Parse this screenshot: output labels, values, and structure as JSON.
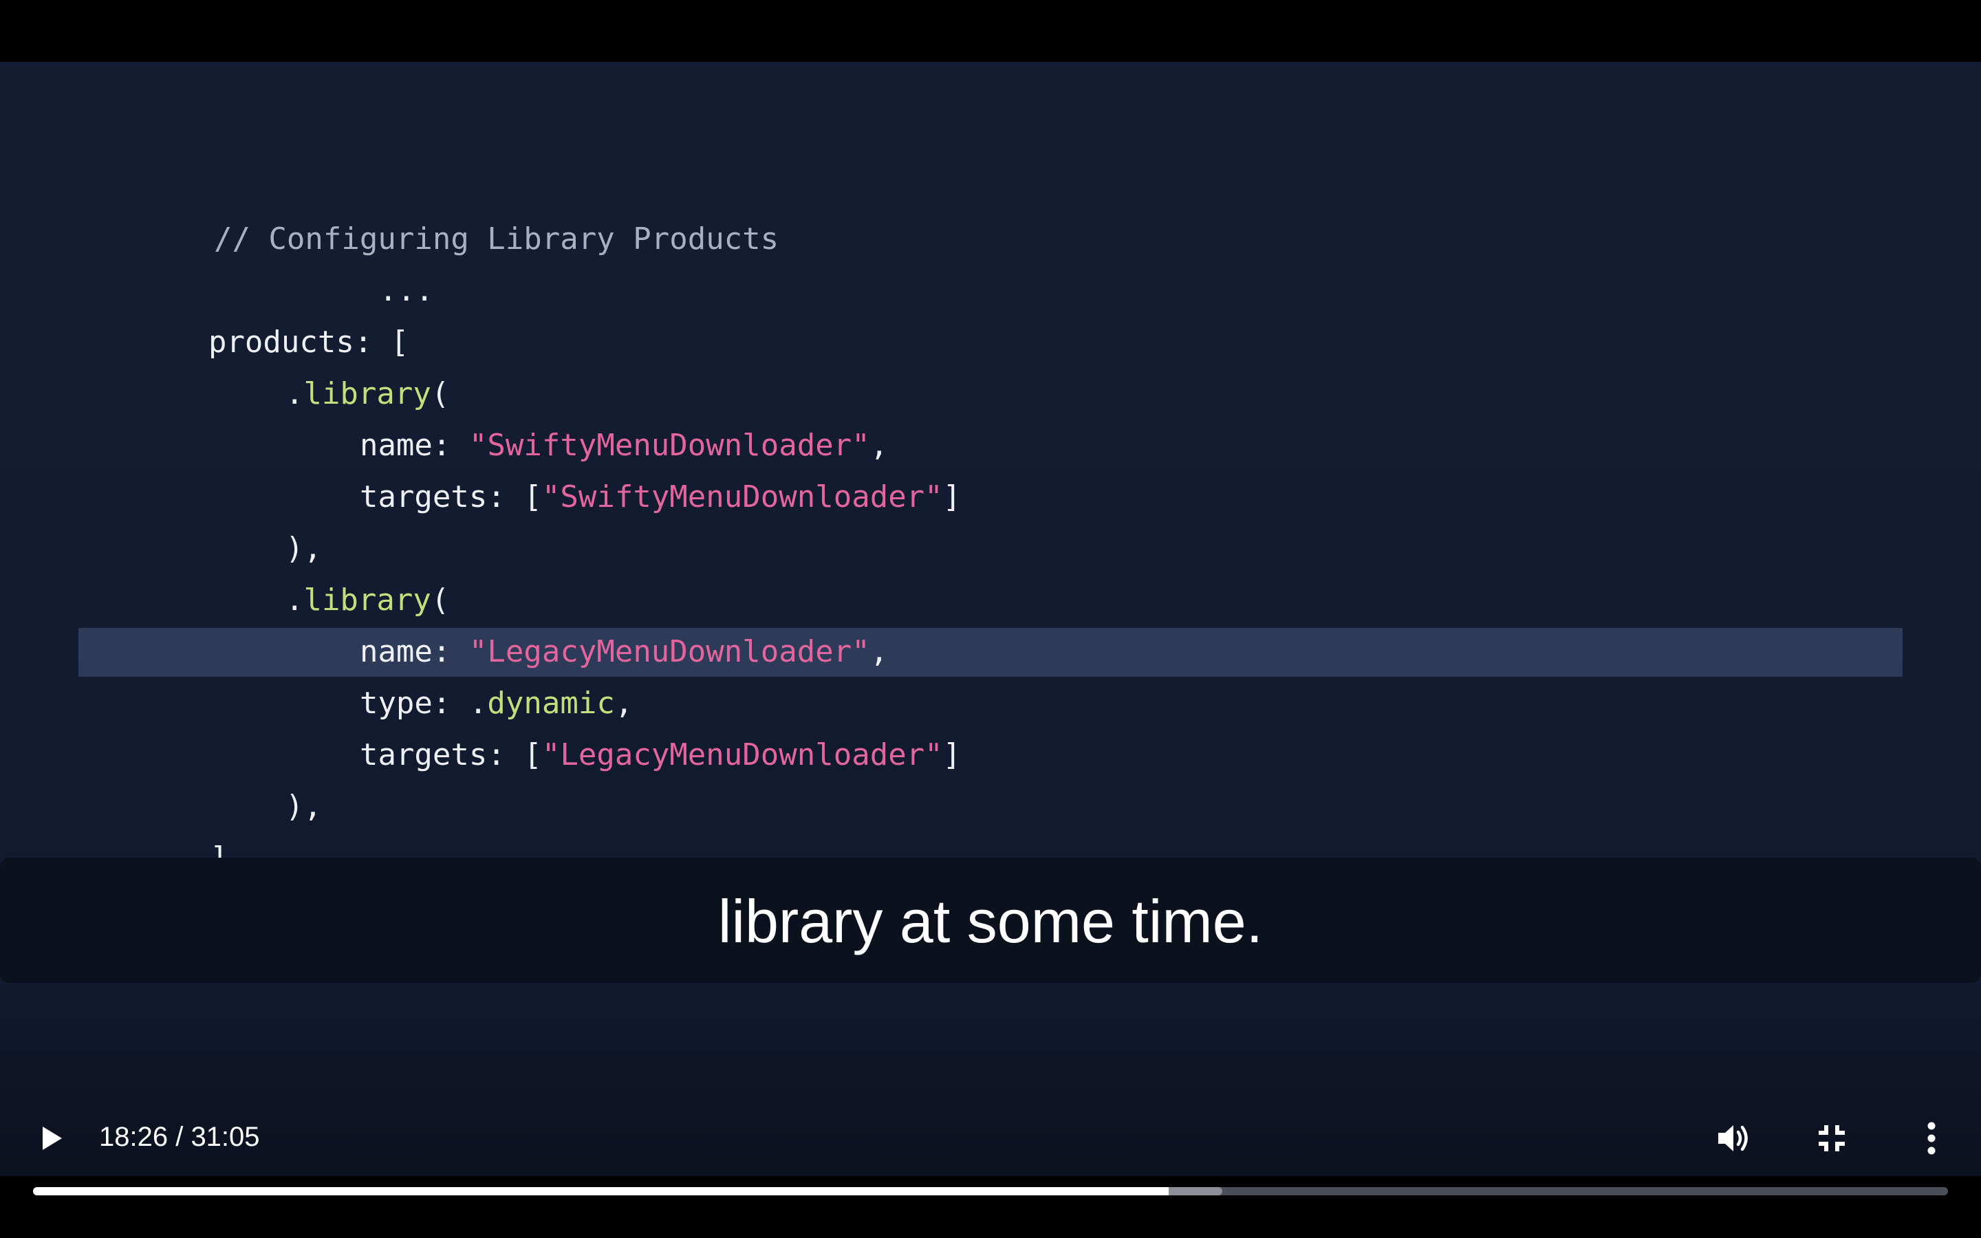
{
  "code": {
    "comment": "// Configuring Library Products",
    "ellipsis": "...",
    "products_key": "products:",
    "open_bracket": "[",
    "library_dot": ".",
    "library_func": "library",
    "open_paren": "(",
    "name_key": "name:",
    "targets_key": "targets:",
    "type_key": "type:",
    "lib1_name": "\"SwiftyMenuDownloader\"",
    "lib1_target": "\"SwiftyMenuDownloader\"",
    "lib2_name": "\"LegacyMenuDownloader\"",
    "lib2_target": "\"LegacyMenuDownloader\"",
    "type_value_dot": ".",
    "type_value": "dynamic",
    "comma": ",",
    "list_open": "[",
    "list_close": "]",
    "close_paren_comma": "),",
    "close_bracket": "]"
  },
  "caption": {
    "text": "library at some time."
  },
  "player": {
    "time": "18:26 / 31:05",
    "progress_fraction": 0.593,
    "buffered_fraction": 0.621,
    "icons": [
      "play-icon",
      "volume-icon",
      "exit-fullscreen-icon",
      "more-options-icon"
    ]
  },
  "colors": {
    "string": "#e3659d",
    "function": "#c3df7c",
    "highlight": "#2d3a58"
  }
}
